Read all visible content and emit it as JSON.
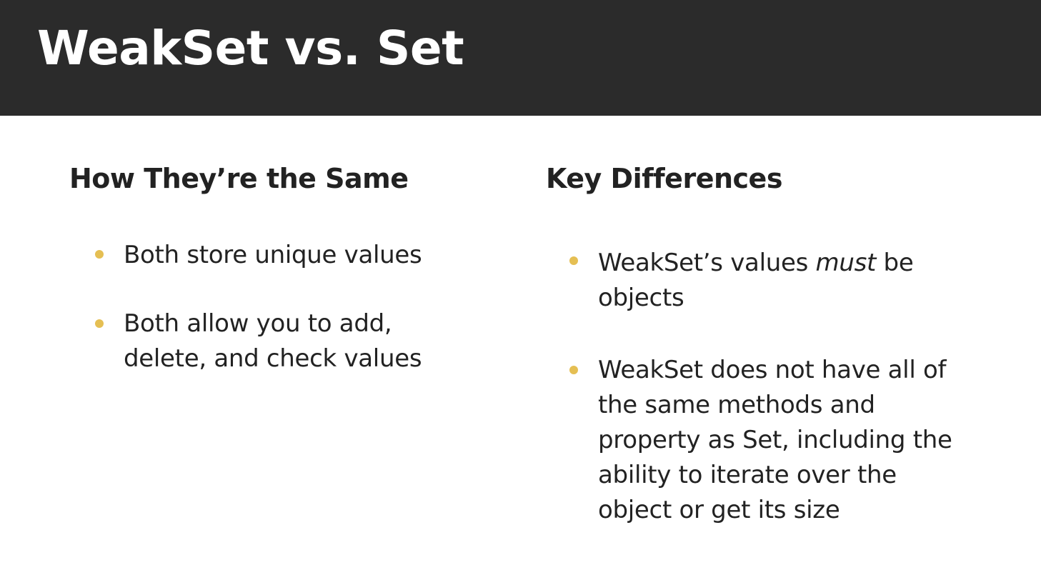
{
  "slide": {
    "title": "WeakSet vs. Set"
  },
  "left_column": {
    "heading": "How They’re the Same",
    "bullets": [
      {
        "text": "Both store unique values"
      },
      {
        "text": "Both allow you to add, delete, and check values"
      }
    ]
  },
  "right_column": {
    "heading": "Key Differences",
    "bullets": [
      {
        "text_before": "WeakSet’s values ",
        "text_emphasis": "must",
        "text_after": " be objects"
      },
      {
        "text": "WeakSet does not have all of the same methods and property as Set, including the ability to iterate over the object or get its size"
      }
    ]
  },
  "colors": {
    "header_background": "#2b2b2b",
    "bullet_accent": "#e5bf53",
    "title_text": "#ffffff",
    "body_text": "#222222"
  }
}
